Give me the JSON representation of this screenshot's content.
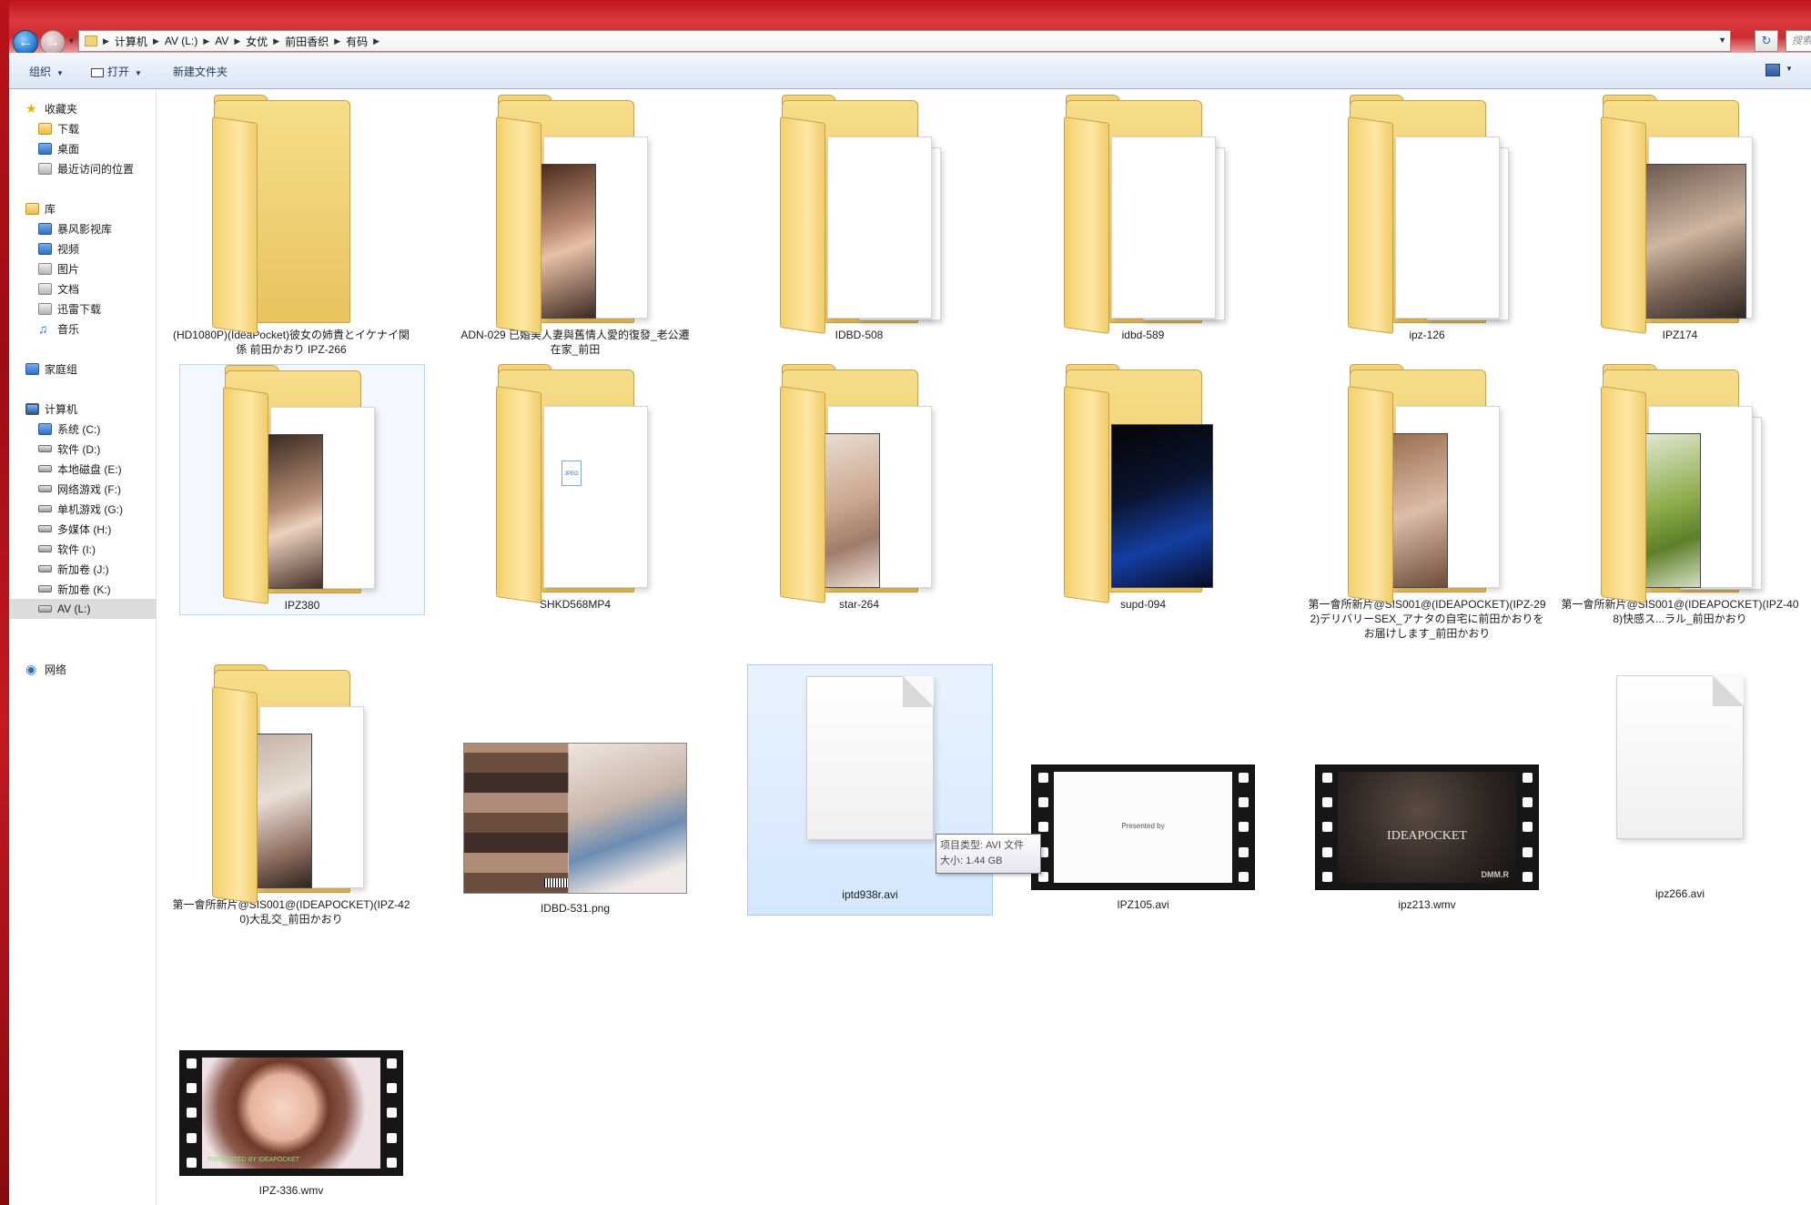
{
  "address": {
    "crumbs": [
      "计算机",
      "AV (L:)",
      "AV",
      "女优",
      "前田香织",
      "有码"
    ],
    "search_placeholder": "搜索"
  },
  "commandbar": {
    "organize": "组织",
    "open": "打开",
    "new_folder": "新建文件夹"
  },
  "navpane": {
    "favorites": "收藏夹",
    "favorites_items": [
      "下载",
      "桌面",
      "最近访问的位置"
    ],
    "libraries": "库",
    "library_items": [
      "暴风影视库",
      "视频",
      "图片",
      "文档",
      "迅雷下载",
      "音乐"
    ],
    "homegroup": "家庭组",
    "computer": "计算机",
    "drives": [
      "系统 (C:)",
      "软件 (D:)",
      "本地磁盘 (E:)",
      "网络游戏 (F:)",
      "单机游戏 (G:)",
      "多媒体 (H:)",
      "软件 (I:)",
      "新加卷 (J:)",
      "新加卷 (K:)",
      "AV (L:)"
    ],
    "network": "网络"
  },
  "items": [
    {
      "name": "(HD1080P)(IdeaPocket)彼女の姉貴とイケナイ関係 前田かおり IPZ-266",
      "kind": "folder"
    },
    {
      "name": "ADN-029 已婚美人妻與舊情人愛的復發_老公遷在家_前田",
      "kind": "folder"
    },
    {
      "name": "IDBD-508",
      "kind": "folder"
    },
    {
      "name": "idbd-589",
      "kind": "folder"
    },
    {
      "name": "ipz-126",
      "kind": "folder"
    },
    {
      "name": "IPZ174",
      "kind": "folder"
    },
    {
      "name": "IPZ380",
      "kind": "folder"
    },
    {
      "name": "SHKD568MP4",
      "kind": "folder"
    },
    {
      "name": "star-264",
      "kind": "folder"
    },
    {
      "name": "supd-094",
      "kind": "folder"
    },
    {
      "name": "第一會所新片@SIS001@(IDEAPOCKET)(IPZ-292)デリバリーSEX_アナタの自宅に前田かおりをお届けします_前田かおり",
      "kind": "folder"
    },
    {
      "name": "第一會所新片@SIS001@(IDEAPOCKET)(IPZ-408)快感ス...ラル_前田かおり",
      "kind": "folder"
    },
    {
      "name": "第一會所新片@SIS001@(IDEAPOCKET)(IPZ-420)大乱交_前田かおり",
      "kind": "folder"
    },
    {
      "name": "IDBD-531.png",
      "kind": "image"
    },
    {
      "name": "iptd938r.avi",
      "kind": "file"
    },
    {
      "name": "IPZ105.avi",
      "kind": "video"
    },
    {
      "name": "ipz213.wmv",
      "kind": "video"
    },
    {
      "name": "ipz266.avi",
      "kind": "file"
    },
    {
      "name": "IPZ-336.wmv",
      "kind": "video"
    }
  ],
  "thumb_text": {
    "presented": "Presented by",
    "ideapocket": "IDEAPOCKET",
    "dmm": "DMM.R",
    "green": "PRESENTED BY IDEAPOCKET",
    "jpeg": "JPEG"
  },
  "tooltip": {
    "type_line": "项目类型: AVI 文件",
    "size_line": "大小: 1.44 GB"
  }
}
